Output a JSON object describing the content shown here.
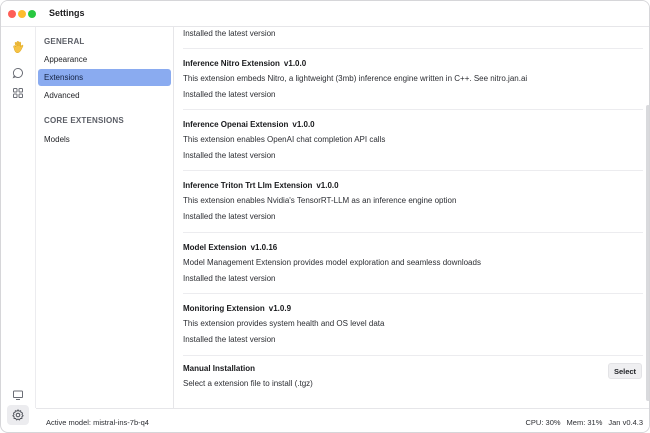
{
  "window": {
    "title": "Settings"
  },
  "rail": {
    "icons": [
      "waving-hand-icon",
      "chat-icon",
      "grid-icon",
      "monitor-icon",
      "gear-icon"
    ]
  },
  "nav": {
    "general_heading": "GENERAL",
    "items": [
      {
        "label": "Appearance"
      },
      {
        "label": "Extensions",
        "active": true
      },
      {
        "label": "Advanced"
      }
    ],
    "core_heading": "CORE EXTENSIONS",
    "core_items": [
      {
        "label": "Models"
      }
    ]
  },
  "extensions": {
    "top_status": "Installed the latest version",
    "list": [
      {
        "name": "Inference Nitro Extension",
        "version": "v1.0.0",
        "description": "This extension embeds Nitro, a lightweight (3mb) inference engine written in C++. See nitro.jan.ai",
        "status": "Installed the latest version"
      },
      {
        "name": "Inference Openai Extension",
        "version": "v1.0.0",
        "description": "This extension enables OpenAI chat completion API calls",
        "status": "Installed the latest version"
      },
      {
        "name": "Inference Triton Trt Llm Extension",
        "version": "v1.0.0",
        "description": "This extension enables Nvidia's TensorRT-LLM as an inference engine option",
        "status": "Installed the latest version"
      },
      {
        "name": "Model Extension",
        "version": "v1.0.16",
        "description": "Model Management Extension provides model exploration and seamless downloads",
        "status": "Installed the latest version"
      },
      {
        "name": "Monitoring Extension",
        "version": "v1.0.9",
        "description": "This extension provides system health and OS level data",
        "status": "Installed the latest version"
      }
    ],
    "manual": {
      "title": "Manual Installation",
      "description": "Select a extension file to install (.tgz)",
      "button_label": "Select"
    }
  },
  "statusbar": {
    "active_model": "Active model: mistral-ins-7b-q4",
    "cpu": "CPU: 30%",
    "mem": "Mem: 31%",
    "version": "Jan v0.4.3"
  }
}
